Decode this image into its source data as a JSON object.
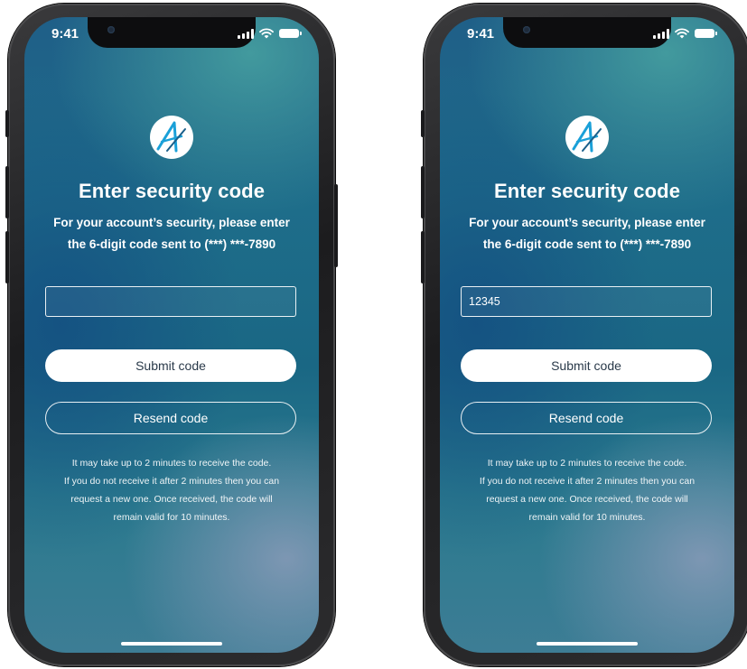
{
  "phones": [
    {
      "status": {
        "time": "9:41"
      },
      "title": "Enter security code",
      "subtitle_line1": "For your account’s security, please enter",
      "subtitle_line2": "the 6-digit code sent to (***) ***-7890",
      "code_field": {
        "value": "",
        "placeholder": ""
      },
      "submit_label": "Submit code",
      "resend_label": "Resend code",
      "help_lines": [
        "It may take up to 2 minutes to receive the code.",
        "If you do not receive it after 2 minutes then you can",
        "request a new one. Once received, the code will",
        "remain valid for 10 minutes."
      ]
    },
    {
      "status": {
        "time": "9:41"
      },
      "title": "Enter security code",
      "subtitle_line1": "For your account’s security, please enter",
      "subtitle_line2": "the 6-digit code sent to (***) ***-7890",
      "code_field": {
        "value": "12345",
        "placeholder": ""
      },
      "submit_label": "Submit code",
      "resend_label": "Resend code",
      "help_lines": [
        "It may take up to 2 minutes to receive the code.",
        "If you do not receive it after 2 minutes then you can",
        "request a new one. Once received, the code will",
        "remain valid for 10 minutes."
      ]
    }
  ],
  "icons": {
    "logo": "brand-logo-icon",
    "signal": "signal-icon",
    "wifi": "wifi-icon",
    "battery": "battery-icon"
  },
  "colors": {
    "background_top": "#1f5f88",
    "background_bottom": "#3d7d95",
    "button_fill": "#ffffff",
    "text": "#ffffff",
    "logo_accent": "#1aa0d8"
  }
}
